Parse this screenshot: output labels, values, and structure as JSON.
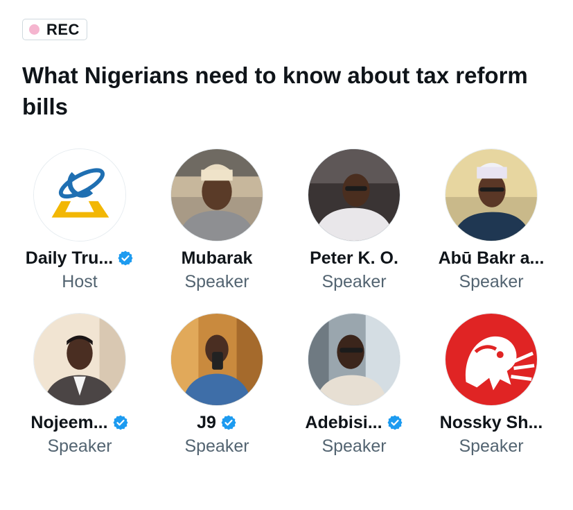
{
  "space": {
    "recording_label": "REC",
    "title": "What Nigerians need to know about tax reform bills"
  },
  "participants": [
    {
      "name": "Daily Tru...",
      "role": "Host",
      "verified": true,
      "avatar": "daily-trust-logo"
    },
    {
      "name": "Mubarak",
      "role": "Speaker",
      "verified": false,
      "avatar": "photo-man-cap-office"
    },
    {
      "name": "Peter K. O.",
      "role": "Speaker",
      "verified": false,
      "avatar": "photo-man-car"
    },
    {
      "name": "Abū Bakr a...",
      "role": "Speaker",
      "verified": false,
      "avatar": "photo-man-cap-glasses"
    },
    {
      "name": "Nojeem...",
      "role": "Speaker",
      "verified": true,
      "avatar": "photo-man-suit"
    },
    {
      "name": "J9",
      "role": "Speaker",
      "verified": true,
      "avatar": "photo-man-selfie"
    },
    {
      "name": "Adebisi...",
      "role": "Speaker",
      "verified": true,
      "avatar": "photo-man-glasses-window"
    },
    {
      "name": "Nossky Sh...",
      "role": "Speaker",
      "verified": false,
      "avatar": "red-lion-logo"
    }
  ],
  "colors": {
    "verified": "#1d9bf0",
    "rec_dot": "#f5b5cf",
    "role_text": "#536471",
    "logo_red": "#e02424",
    "logo_blue": "#1f6fb2",
    "logo_yellow": "#f2b705"
  }
}
